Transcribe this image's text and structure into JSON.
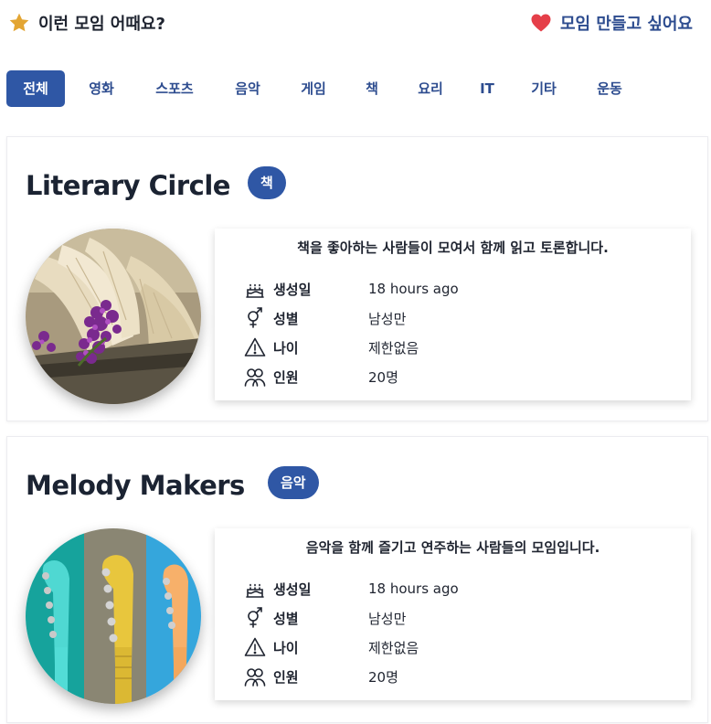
{
  "header": {
    "title": "이런 모임 어때요?",
    "title_icon": "star-icon",
    "create_label": "모임 만들고 싶어요",
    "create_icon": "heart-icon",
    "colors": {
      "star": "#e3a533",
      "heart": "#e53f49",
      "accent": "#2d4c8f"
    }
  },
  "tabs": [
    {
      "label": "전체",
      "active": true
    },
    {
      "label": "영화",
      "active": false
    },
    {
      "label": "스포츠",
      "active": false
    },
    {
      "label": "음악",
      "active": false
    },
    {
      "label": "게임",
      "active": false
    },
    {
      "label": "책",
      "active": false
    },
    {
      "label": "요리",
      "active": false
    },
    {
      "label": "IT",
      "active": false
    },
    {
      "label": "기타",
      "active": false
    },
    {
      "label": "운동",
      "active": false
    }
  ],
  "groups": [
    {
      "title": "Literary Circle",
      "category": "책",
      "image": "open-book-with-purple-flowers",
      "description": "책을 좋아하는 사람들이 모여서 함께 읽고 토론합니다.",
      "fields": {
        "created": {
          "label": "생성일",
          "value": "18 hours ago",
          "icon": "cake-icon"
        },
        "gender": {
          "label": "성별",
          "value": "남성만",
          "icon": "gender-icon"
        },
        "age": {
          "label": "나이",
          "value": "제한없음",
          "icon": "warning-icon"
        },
        "members": {
          "label": "인원",
          "value": "20명",
          "icon": "users-icon"
        }
      }
    },
    {
      "title": "Melody Makers",
      "category": "음악",
      "image": "colorful-guitar-headstocks",
      "description": "음악을 함께 즐기고 연주하는 사람들의 모임입니다.",
      "fields": {
        "created": {
          "label": "생성일",
          "value": "18 hours ago",
          "icon": "cake-icon"
        },
        "gender": {
          "label": "성별",
          "value": "남성만",
          "icon": "gender-icon"
        },
        "age": {
          "label": "나이",
          "value": "제한없음",
          "icon": "warning-icon"
        },
        "members": {
          "label": "인원",
          "value": "20명",
          "icon": "users-icon"
        }
      }
    }
  ]
}
